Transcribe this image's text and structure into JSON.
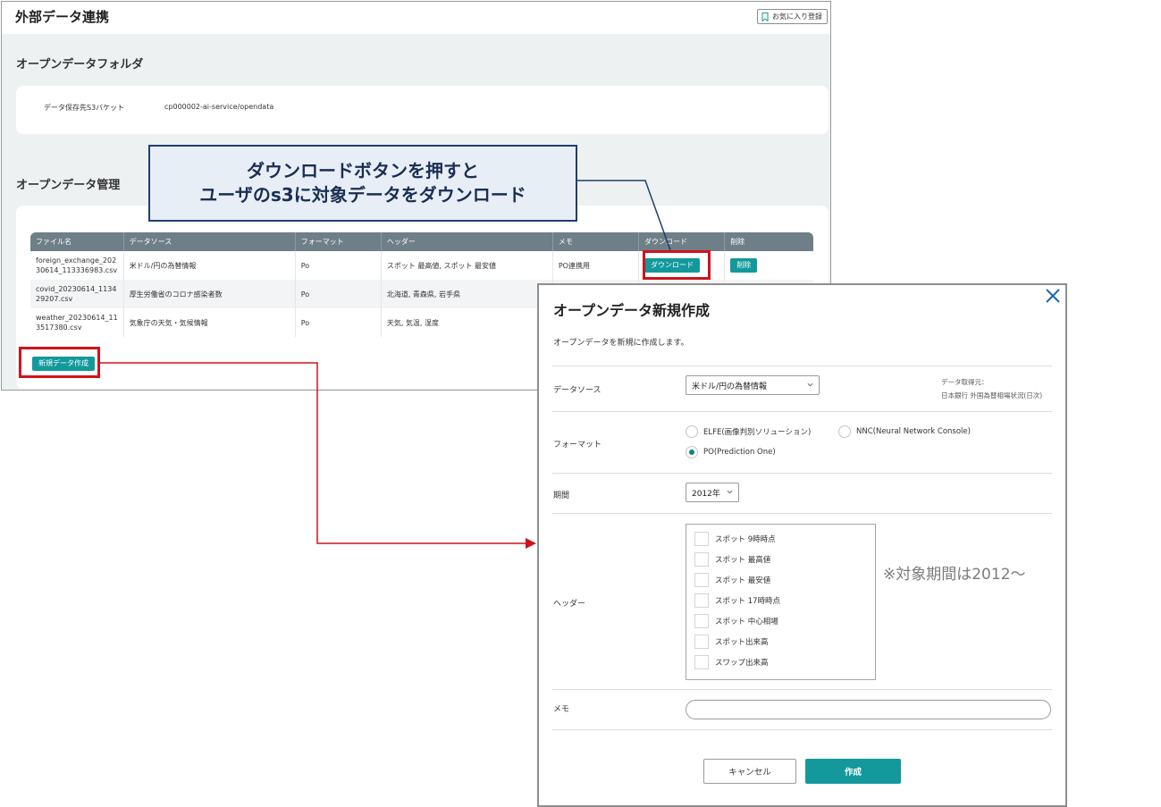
{
  "window": {
    "title": "外部データ連携",
    "favorite_label": "お気に入り登録"
  },
  "open_folder": {
    "title": "オープンデータフォルダ",
    "bucket_label": "データ保存先S3バケット",
    "bucket_value": "cp000002-ai-service/opendata"
  },
  "open_data_mgmt": {
    "title": "オープンデータ管理",
    "columns": [
      "ファイル名",
      "データソース",
      "フォーマット",
      "ヘッダー",
      "メモ",
      "ダウンロード",
      "削除"
    ],
    "rows": [
      {
        "file_line1": "foreign_exchange_202",
        "file_line2": "30614_113336983.csv",
        "source": "米ドル/円の為替情報",
        "format": "Po",
        "header": "スポット 最高値, スポット 最安値",
        "memo": "PO連携用",
        "download_label": "ダウンロード",
        "delete_label": "削除"
      },
      {
        "file_line1": "covid_20230614_1134",
        "file_line2": "29207.csv",
        "source": "厚生労働省のコロナ感染者数",
        "format": "Po",
        "header": "北海道, 青森県, 岩手県",
        "memo": "",
        "download_label": "",
        "delete_label": ""
      },
      {
        "file_line1": "weather_20230614_11",
        "file_line2": "3517380.csv",
        "source": "気象庁の天気・気候情報",
        "format": "Po",
        "header": "天気, 気温, 湿度",
        "memo": "",
        "download_label": "",
        "delete_label": ""
      }
    ],
    "new_button": "新規データ作成"
  },
  "callout": {
    "line1": "ダウンロードボタンを押すと",
    "line2": "ユーザのs3に対象データをダウンロード"
  },
  "dialog": {
    "title": "オープンデータ新規作成",
    "description": "オープンデータを新規に作成します。",
    "source_label": "データソース",
    "source_value": "米ドル/円の為替情報",
    "source_note_line1": "データ取得元：",
    "source_note_line2": "日本銀行 外国為替相場状況(日次)",
    "format_label": "フォーマット",
    "format_options": [
      "ELFE(画像判別ソリューション)",
      "NNC(Neural Network Console)",
      "PO(Prediction One)"
    ],
    "format_selected": "PO(Prediction One)",
    "period_label": "期間",
    "period_value": "2012年",
    "header_label": "ヘッダー",
    "header_options": [
      "スポット 9時時点",
      "スポット 最高値",
      "スポット 最安値",
      "スポット 17時時点",
      "スポット 中心相場",
      "スポット出来高",
      "スワップ出来高"
    ],
    "period_note": "※対象期間は2012〜",
    "memo_label": "メモ",
    "memo_value": "",
    "cancel_label": "キャンセル",
    "create_label": "作成"
  },
  "colors": {
    "accent_teal": "#13999c",
    "table_header": "#6f7f87",
    "highlight_red": "#d1121b",
    "callout_navy": "#1f3f6d"
  },
  "icons": [
    "bookmark-icon",
    "chevron-down-icon",
    "close-icon"
  ]
}
